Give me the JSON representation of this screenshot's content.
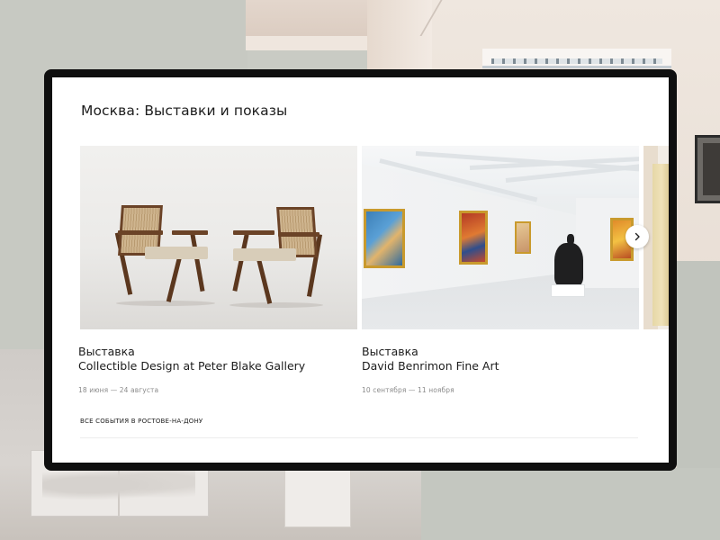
{
  "page": {
    "title": "Москва: Выставки и показы"
  },
  "cards": [
    {
      "kind": "Выставка",
      "title": "Collectible Design at Peter Blake Gallery",
      "dates": "18 июня — 24 августа",
      "image": "chairs-photo"
    },
    {
      "kind": "Выставка",
      "title": "David Benrimon Fine Art",
      "dates": "10 сентября — 11 ноября",
      "image": "gallery-interior-photo"
    },
    {
      "kind": "",
      "title": "",
      "dates": "",
      "image": "partial-photo"
    }
  ],
  "carousel": {
    "next_icon": "chevron-right-icon"
  },
  "footer": {
    "all_events_link": "ВСЕ СОБЫТИЯ В РОСТОВЕ-НА-ДОНУ"
  },
  "colors": {
    "frame": "#0f0f0f",
    "background": "#c9cbc4",
    "dates_text": "#8b8b8b",
    "accent_frame": "#c99a2d"
  }
}
